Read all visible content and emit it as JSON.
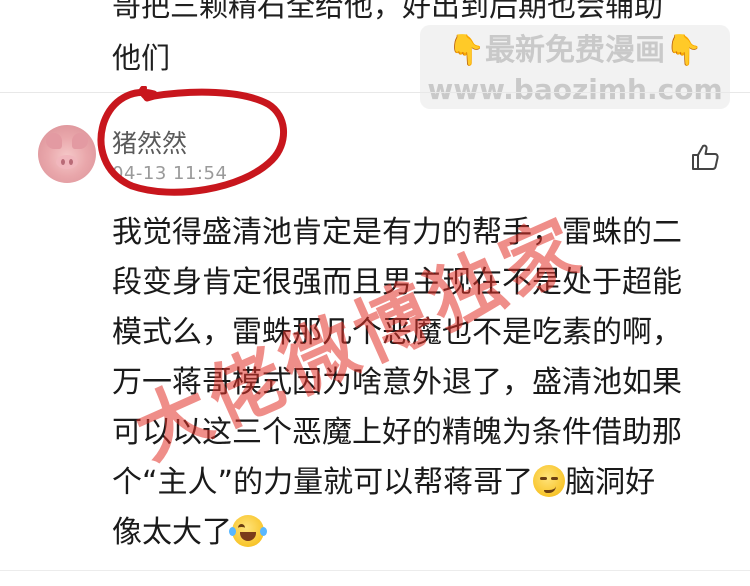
{
  "previous_comment": {
    "line1": "哥把三颗精石全给他，好出到后期也会辅助",
    "line2": "他们"
  },
  "watermark": {
    "line1": "👇最新免费漫画👇",
    "line2": "www.baozimh.com"
  },
  "comment": {
    "username": "猪然然",
    "timestamp": "04-13 11:54",
    "lines": [
      "我觉得盛清池肯定是有力的帮手，雷蛛的二",
      "段变身肯定很强而且男主现在不是处于超能",
      "模式么，雷蛛那几个恶魔也不是吃素的啊，",
      "万一蒋哥模式因为啥意外退了，盛清池如果",
      "可以以这三个恶魔上好的精魄为条件借助那",
      "个“主人”的力量就可以帮蒋哥了",
      "脑洞好",
      "像太大了"
    ]
  },
  "stamp": {
    "text": "大佬微博独家"
  },
  "icons": {
    "like": "thumbs-up-icon",
    "smirk": "smirk-emoji-icon",
    "laugh": "tears-of-joy-emoji-icon"
  },
  "colors": {
    "stamp_red": "#e13228",
    "circle_red": "#c8161d",
    "text_gray": "#9a9a9a"
  }
}
